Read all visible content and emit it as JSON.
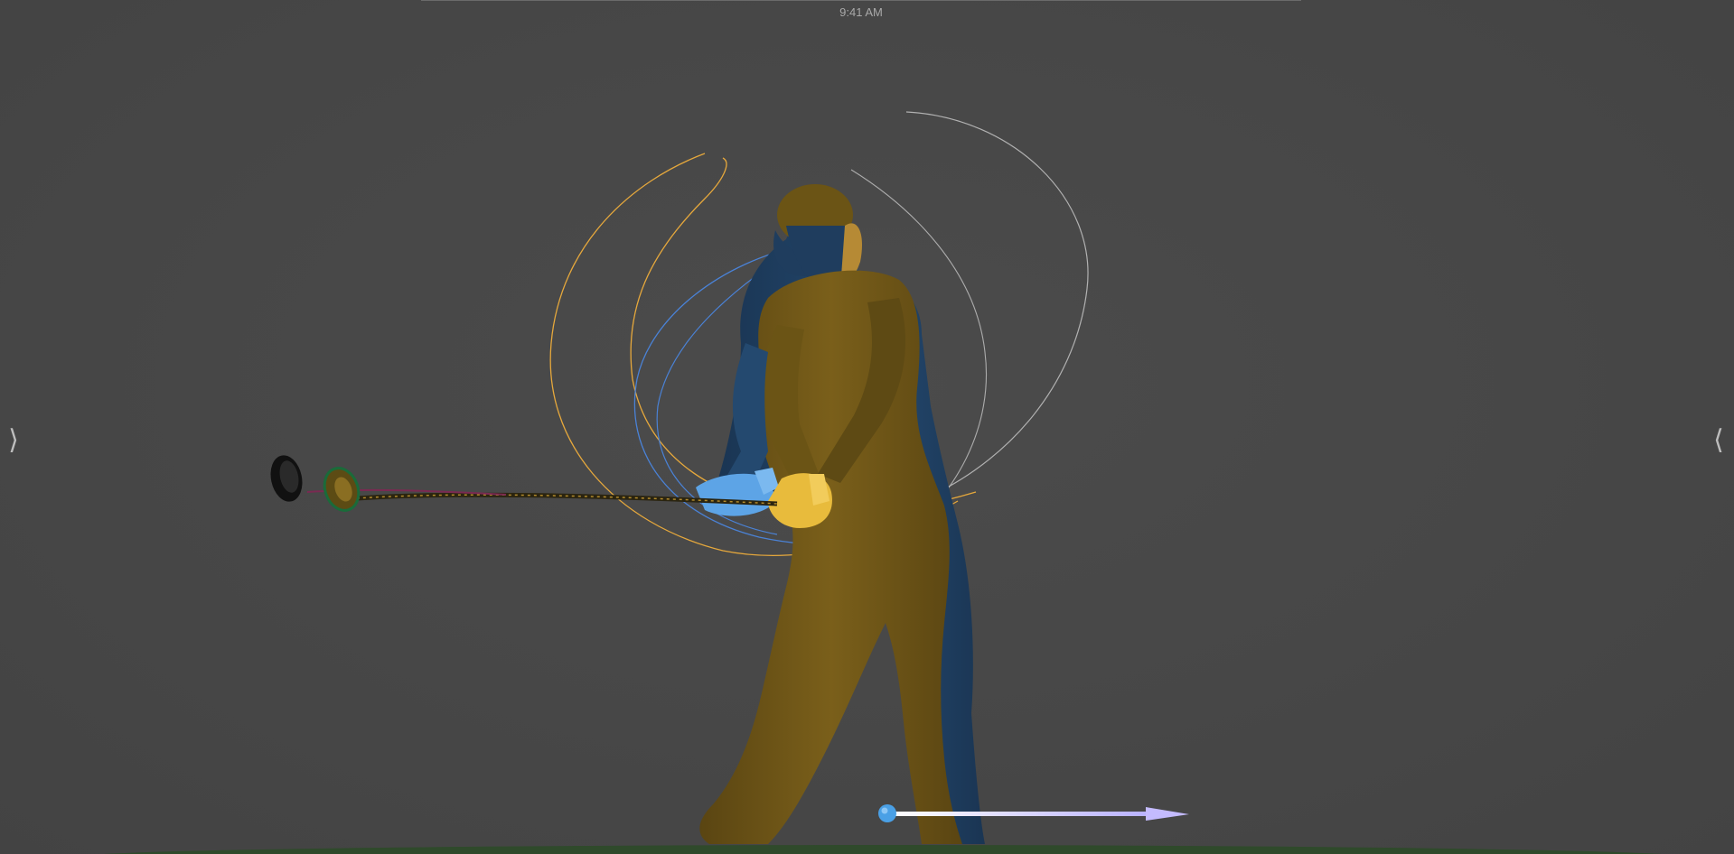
{
  "status_bar": {
    "time": "9:41 AM"
  },
  "navigation": {
    "prev_icon": "chevron-right-icon",
    "next_icon": "chevron-left-icon",
    "prev_glyph": "⟩",
    "next_glyph": "⟨"
  },
  "scene": {
    "description_icons": [
      "golfer-model",
      "club-head",
      "swing-path",
      "ball",
      "target-arrow"
    ],
    "colors": {
      "background": "#474747",
      "golfer_body": "#6b5415",
      "golfer_shadow_body": "#1f3d5e",
      "club_path": "#e0a83a",
      "hand_path": "#4a82d6",
      "head_path": "#c9c9c9",
      "lead_hands": "#e8bb3c",
      "trail_hands": "#5da4e6",
      "ground": "#2f4a2b",
      "target_arrow": "#d8d4ff",
      "ball": "#4aa0e6"
    }
  }
}
